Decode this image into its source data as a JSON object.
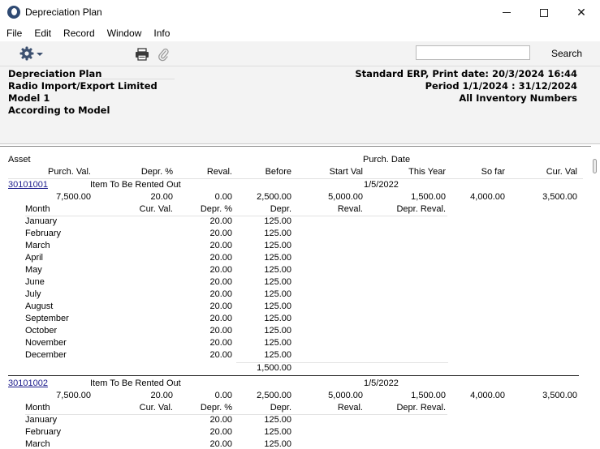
{
  "window": {
    "title": "Depreciation Plan"
  },
  "menu": [
    "File",
    "Edit",
    "Record",
    "Window",
    "Info"
  ],
  "toolbar": {
    "search_value": "",
    "search_label": "Search"
  },
  "header": {
    "left": [
      "Depreciation Plan",
      "Radio Import/Export Limited",
      "Model 1",
      "According to Model"
    ],
    "right": [
      "Standard ERP, Print date: 20/3/2024 16:44",
      "Period  1/1/2024 : 31/12/2024",
      "All Inventory Numbers"
    ]
  },
  "report": {
    "col_headers_1": {
      "asset": "Asset",
      "purch_date": "Purch. Date"
    },
    "col_headers_2": [
      "Purch. Val.",
      "Depr. %",
      "Reval.",
      "Before",
      "Start Val",
      "This Year",
      "So far",
      "Cur. Val"
    ],
    "month_headers": [
      "Month",
      "Cur. Val.",
      "Depr. %",
      "Depr.",
      "Reval.",
      "Depr. Reval."
    ],
    "assets": [
      {
        "code": "30101001",
        "name": "Item To Be Rented Out",
        "purch_date": "1/5/2022",
        "values": [
          "7,500.00",
          "20.00",
          "0.00",
          "2,500.00",
          "5,000.00",
          "1,500.00",
          "4,000.00",
          "3,500.00"
        ],
        "months": [
          {
            "month": "January",
            "pct": "20.00",
            "depr": "125.00"
          },
          {
            "month": "February",
            "pct": "20.00",
            "depr": "125.00"
          },
          {
            "month": "March",
            "pct": "20.00",
            "depr": "125.00"
          },
          {
            "month": "April",
            "pct": "20.00",
            "depr": "125.00"
          },
          {
            "month": "May",
            "pct": "20.00",
            "depr": "125.00"
          },
          {
            "month": "June",
            "pct": "20.00",
            "depr": "125.00"
          },
          {
            "month": "July",
            "pct": "20.00",
            "depr": "125.00"
          },
          {
            "month": "August",
            "pct": "20.00",
            "depr": "125.00"
          },
          {
            "month": "September",
            "pct": "20.00",
            "depr": "125.00"
          },
          {
            "month": "October",
            "pct": "20.00",
            "depr": "125.00"
          },
          {
            "month": "November",
            "pct": "20.00",
            "depr": "125.00"
          },
          {
            "month": "December",
            "pct": "20.00",
            "depr": "125.00"
          }
        ],
        "total": "1,500.00"
      },
      {
        "code": "30101002",
        "name": "Item To Be Rented Out",
        "purch_date": "1/5/2022",
        "values": [
          "7,500.00",
          "20.00",
          "0.00",
          "2,500.00",
          "5,000.00",
          "1,500.00",
          "4,000.00",
          "3,500.00"
        ],
        "months": [
          {
            "month": "January",
            "pct": "20.00",
            "depr": "125.00"
          },
          {
            "month": "February",
            "pct": "20.00",
            "depr": "125.00"
          },
          {
            "month": "March",
            "pct": "20.00",
            "depr": "125.00"
          }
        ],
        "total": ""
      }
    ]
  }
}
